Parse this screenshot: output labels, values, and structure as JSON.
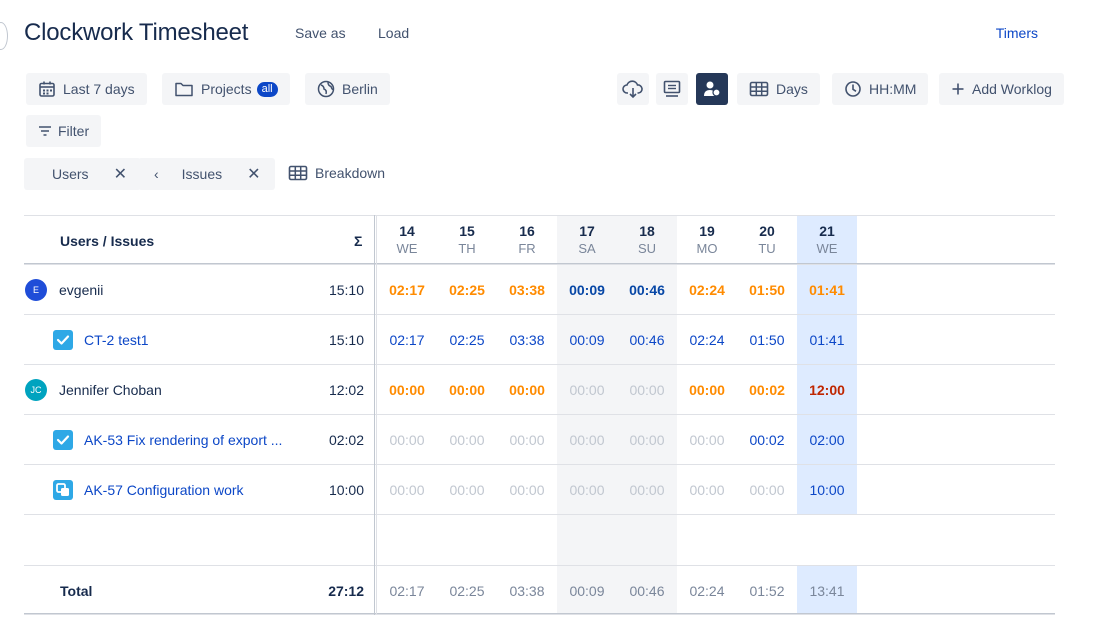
{
  "header": {
    "title": "Clockwork Timesheet",
    "save_as": "Save as",
    "load": "Load",
    "timers": "Timers"
  },
  "toolbar": {
    "period": "Last 7 days",
    "projects": "Projects",
    "projects_badge": "all",
    "timezone": "Berlin",
    "days": "Days",
    "time_format": "HH:MM",
    "add_worklog": "Add Worklog",
    "filter": "Filter",
    "icons": [
      "calendar-icon",
      "folder-icon",
      "globe-icon",
      "cloud-download-icon",
      "monitor-icon",
      "users-icon",
      "grid-icon",
      "clock-icon",
      "plus-icon",
      "filter-icon"
    ]
  },
  "grouping": {
    "chips": [
      {
        "label": "Users"
      },
      {
        "label": "Issues",
        "prefix": "‹"
      }
    ],
    "breakdown": "Breakdown"
  },
  "table": {
    "header_label": "Users / Issues",
    "sum_symbol": "Σ",
    "days": [
      {
        "num": "14",
        "name": "WE",
        "kind": "weekday"
      },
      {
        "num": "15",
        "name": "TH",
        "kind": "weekday"
      },
      {
        "num": "16",
        "name": "FR",
        "kind": "weekday"
      },
      {
        "num": "17",
        "name": "SA",
        "kind": "weekend"
      },
      {
        "num": "18",
        "name": "SU",
        "kind": "weekend"
      },
      {
        "num": "19",
        "name": "MO",
        "kind": "weekday"
      },
      {
        "num": "20",
        "name": "TU",
        "kind": "weekday"
      },
      {
        "num": "21",
        "name": "WE",
        "kind": "today"
      }
    ],
    "rows": [
      {
        "type": "user",
        "label": "evgenii",
        "avatar": "E",
        "avatar_color": "#1f4dd8",
        "total": "15:10",
        "cells": [
          [
            "02:17",
            "orange"
          ],
          [
            "02:25",
            "orange"
          ],
          [
            "03:38",
            "orange"
          ],
          [
            "00:09",
            "blue-b"
          ],
          [
            "00:46",
            "blue-b"
          ],
          [
            "02:24",
            "orange"
          ],
          [
            "01:50",
            "orange"
          ],
          [
            "01:41",
            "orange"
          ]
        ]
      },
      {
        "type": "issue",
        "label": "CT-2 test1",
        "icon": "task-checkbox-icon",
        "total": "15:10",
        "cells": [
          [
            "02:17",
            "blue"
          ],
          [
            "02:25",
            "blue"
          ],
          [
            "03:38",
            "blue"
          ],
          [
            "00:09",
            "blue"
          ],
          [
            "00:46",
            "blue"
          ],
          [
            "02:24",
            "blue"
          ],
          [
            "01:50",
            "blue"
          ],
          [
            "01:41",
            "blue"
          ]
        ]
      },
      {
        "type": "user",
        "label": "Jennifer Choban",
        "avatar": "JC",
        "avatar_color": "#00a3bf",
        "total": "12:02",
        "cells": [
          [
            "00:00",
            "orange"
          ],
          [
            "00:00",
            "orange"
          ],
          [
            "00:00",
            "orange"
          ],
          [
            "00:00",
            "gray"
          ],
          [
            "00:00",
            "gray"
          ],
          [
            "00:00",
            "orange"
          ],
          [
            "00:02",
            "orange"
          ],
          [
            "12:00",
            "red"
          ]
        ]
      },
      {
        "type": "issue",
        "label": "AK-53 Fix rendering of export ...",
        "icon": "task-checkbox-icon",
        "total": "02:02",
        "cells": [
          [
            "00:00",
            "gray"
          ],
          [
            "00:00",
            "gray"
          ],
          [
            "00:00",
            "gray"
          ],
          [
            "00:00",
            "gray"
          ],
          [
            "00:00",
            "gray"
          ],
          [
            "00:00",
            "gray"
          ],
          [
            "00:02",
            "blue"
          ],
          [
            "02:00",
            "blue"
          ]
        ]
      },
      {
        "type": "issue",
        "label": "AK-57 Configuration work",
        "icon": "subtask-icon",
        "total": "10:00",
        "cells": [
          [
            "00:00",
            "gray"
          ],
          [
            "00:00",
            "gray"
          ],
          [
            "00:00",
            "gray"
          ],
          [
            "00:00",
            "gray"
          ],
          [
            "00:00",
            "gray"
          ],
          [
            "00:00",
            "gray"
          ],
          [
            "00:00",
            "gray"
          ],
          [
            "10:00",
            "blue"
          ]
        ]
      }
    ],
    "total_row": {
      "label": "Total",
      "total": "27:12",
      "cells": [
        "02:17",
        "02:25",
        "03:38",
        "00:09",
        "00:46",
        "02:24",
        "01:52",
        "13:41"
      ]
    }
  },
  "colors": {
    "accent": "#0c47c7",
    "orange": "#ff8b00",
    "red": "#bf2600",
    "today_bg": "#deebff",
    "weekend_bg": "#f4f5f7"
  }
}
